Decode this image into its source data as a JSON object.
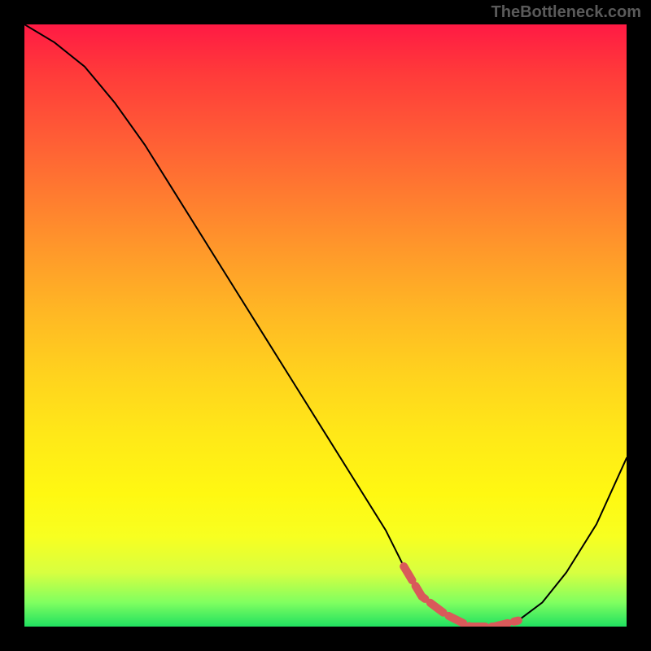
{
  "watermark": "TheBottleneck.com",
  "chart_data": {
    "type": "line",
    "title": "",
    "xlabel": "",
    "ylabel": "",
    "xlim": [
      0,
      100
    ],
    "ylim": [
      0,
      100
    ],
    "grid": false,
    "x": [
      0,
      5,
      10,
      15,
      20,
      25,
      30,
      35,
      40,
      45,
      50,
      55,
      60,
      63,
      66,
      70,
      74,
      78,
      82,
      86,
      90,
      95,
      100
    ],
    "values": [
      100,
      97,
      93,
      87,
      80,
      72,
      64,
      56,
      48,
      40,
      32,
      24,
      16,
      10,
      5,
      2,
      0,
      0,
      1,
      4,
      9,
      17,
      28
    ],
    "series": [
      {
        "name": "bottleneck-curve",
        "x": [
          0,
          5,
          10,
          15,
          20,
          25,
          30,
          35,
          40,
          45,
          50,
          55,
          60,
          63,
          66,
          70,
          74,
          78,
          82,
          86,
          90,
          95,
          100
        ],
        "values": [
          100,
          97,
          93,
          87,
          80,
          72,
          64,
          56,
          48,
          40,
          32,
          24,
          16,
          10,
          5,
          2,
          0,
          0,
          1,
          4,
          9,
          17,
          28
        ]
      }
    ],
    "highlight_segment": {
      "color": "#d95a5a",
      "x": [
        63,
        66,
        70,
        74,
        78,
        82
      ],
      "values": [
        10,
        5,
        2,
        0,
        0,
        1
      ]
    },
    "background_gradient": {
      "top": "#ff1a44",
      "mid": "#ffd21e",
      "bottom": "#20e060"
    }
  }
}
